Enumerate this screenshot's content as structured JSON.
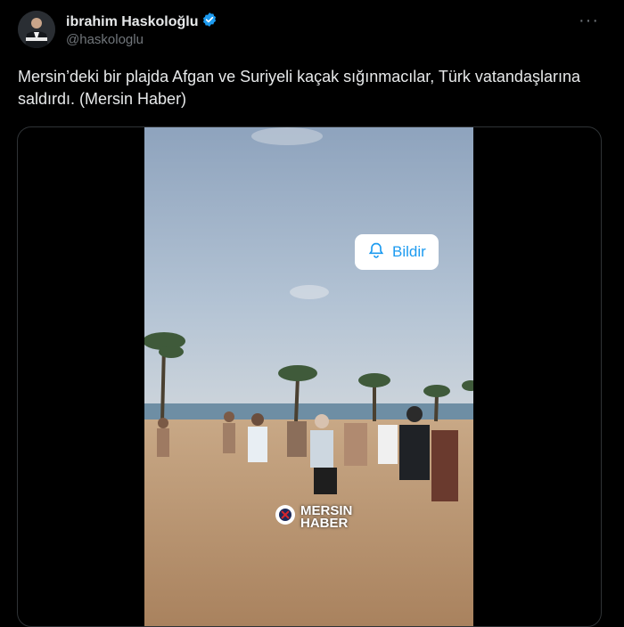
{
  "author": {
    "name": "ibrahim Haskoloğlu",
    "handle": "@haskologlu"
  },
  "menu": {
    "label": "···"
  },
  "tweet": {
    "text": "Mersin’deki bir plajda Afgan ve Suriyeli kaçak sığınmacılar, Türk vatandaşlarına saldırdı. (Mersin Haber)"
  },
  "video": {
    "notify_label": "Bildir",
    "logo_line1": "MERSIN",
    "logo_line2": "HABER"
  },
  "colors": {
    "background": "#000000",
    "text": "#e7e9ea",
    "muted": "#71767b",
    "accent": "#1d9bf0",
    "border": "#2f3336"
  },
  "icons": [
    "verified-badge-icon",
    "more-options-icon",
    "bell-icon",
    "logo-mark-icon"
  ]
}
